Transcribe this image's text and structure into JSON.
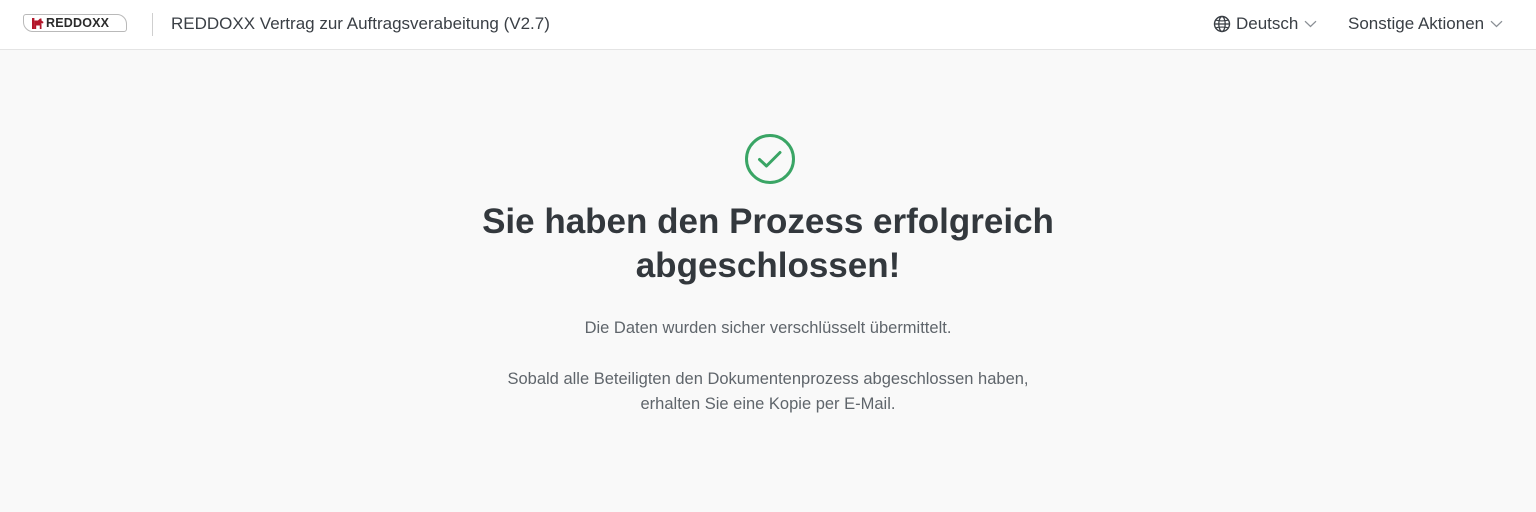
{
  "header": {
    "logo_text": "REDDOXX",
    "document_title": "REDDOXX Vertrag zur Auftragsverabeitung (V2.7)",
    "language_label": "Deutsch",
    "language_icon": "globe-icon",
    "actions_label": "Sonstige Aktionen",
    "dropdown_icon": "chevron-down-icon"
  },
  "main": {
    "status_icon": "check-circle-icon",
    "headline_line1": "Sie haben den Prozess erfolgreich",
    "headline_line2": "abgeschlossen!",
    "message_1": "Die Daten wurden sicher verschlüsselt übermittelt.",
    "message_2_line1": "Sobald alle Beteiligten den Dokumentenprozess abgeschlossen haben,",
    "message_2_line2": "erhalten Sie eine Kopie per E-Mail."
  },
  "colors": {
    "success": "#3aa565",
    "brand_red": "#b3172b",
    "background": "#f9f9f9",
    "header_background": "#ffffff"
  }
}
